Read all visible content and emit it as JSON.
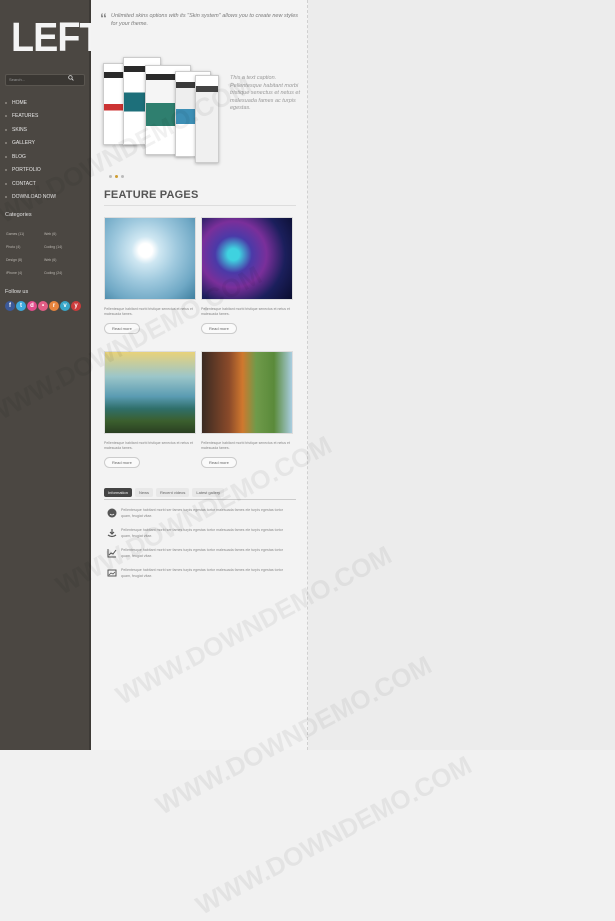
{
  "sidebar": {
    "logo": "LEFT",
    "search_placeholder": "Search...",
    "nav": [
      "HOME",
      "FEATURES",
      "SKINS",
      "GALLERY",
      "BLOG",
      "PORTFOLIO",
      "CONTACT",
      "DOWNLOAD NOW!"
    ],
    "categories_title": "Categories",
    "categories": [
      [
        "Games (11)",
        "Web (6)"
      ],
      [
        "Photo (4)",
        "Coding (14)"
      ],
      [
        "Design (8)",
        "Web (6)"
      ],
      [
        "iPhone (4)",
        "Coding (24)"
      ]
    ],
    "follow_title": "Follow us",
    "social": [
      {
        "name": "facebook-icon",
        "glyph": "f",
        "color": "#3b5998"
      },
      {
        "name": "twitter-icon",
        "glyph": "t",
        "color": "#3fa9dc"
      },
      {
        "name": "dribbble-icon",
        "glyph": "d",
        "color": "#e04d8c"
      },
      {
        "name": "flickr-icon",
        "glyph": "•",
        "color": "#e05d85"
      },
      {
        "name": "rss-icon",
        "glyph": "r",
        "color": "#e7843d"
      },
      {
        "name": "vimeo-icon",
        "glyph": "v",
        "color": "#38a6c8"
      },
      {
        "name": "youtube-icon",
        "glyph": "y",
        "color": "#cc3b3b"
      }
    ]
  },
  "main": {
    "quote": "Unlimited skins options with its \"Skin system\" allows you to create new styles for your theme.",
    "slider_caption": "This a text caption. Pellentesque habitant morbi tristique senectus et netus et malesuada fames ac turpis egestas.",
    "feature_title": "FEATURE PAGES",
    "cards": [
      {
        "text": "Pellentesque habitant morbi tristique senectus et netus et malesuada fames.",
        "button": "Read more"
      },
      {
        "text": "Pellentesque habitant morbi tristique senectus et netus et malesuada fames.",
        "button": "Read more"
      },
      {
        "text": "Pellentesque habitant morbi tristique senectus et netus et malesuada fames.",
        "button": "Read more"
      },
      {
        "text": "Pellentesque habitant morbi tristique senectus et netus et malesuada fames.",
        "button": "Read more"
      }
    ],
    "tabs": [
      "Information",
      "News",
      "Recent videos",
      "Latest gallery"
    ],
    "entries": [
      "Pellentesque habitant morbi ser fames turpis egestas tortor malesuada fames ele turpis egestas tortor quam, feugiat vitae.",
      "Pellentesque habitant morbi ser fames turpis egestas tortor malesuada fames ele turpis egestas tortor quam, feugiat vitae.",
      "Pellentesque habitant morbi ser fames turpis egestas tortor malesuada fames ele turpis egestas tortor quam, feugiat vitae.",
      "Pellentesque habitant morbi ser fames turpis egestas tortor malesuada fames ele turpis egestas tortor quam, feugiat vitae."
    ]
  },
  "watermark": "WWW.DOWNDEMO.COM"
}
